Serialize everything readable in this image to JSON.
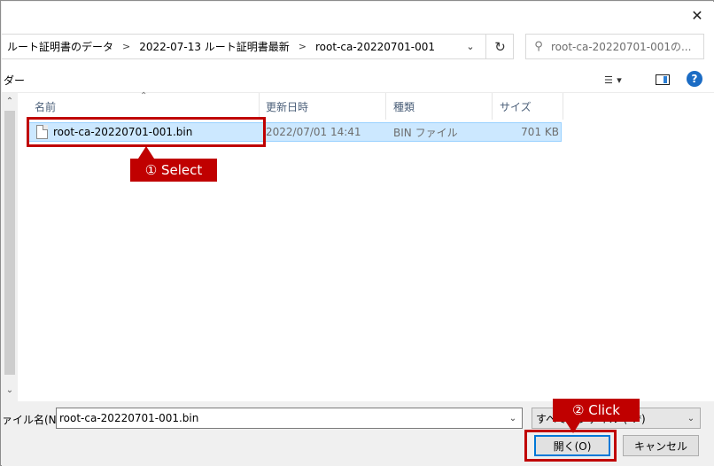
{
  "window": {
    "close_glyph": "✕"
  },
  "address": {
    "crumbs": [
      "ルート証明書のデータ",
      "2022-07-13 ルート証明書最新",
      "root-ca-20220701-001"
    ],
    "separator": ">",
    "dropdown_icon": "chevron-down-icon",
    "refresh_icon": "refresh-icon"
  },
  "search": {
    "placeholder": "root-ca-20220701-001の...",
    "icon": "search-icon"
  },
  "toolbar": {
    "left_text": "ダー",
    "view_icon": "view-options-icon",
    "pane_icon": "preview-pane-icon",
    "help_label": "?"
  },
  "list": {
    "columns": [
      "名前",
      "更新日時",
      "種類",
      "サイズ"
    ],
    "rows": [
      {
        "name": "root-ca-20220701-001.bin",
        "date": "2022/07/01 14:41",
        "type": "BIN ファイル",
        "size": "701 KB",
        "selected": true
      }
    ]
  },
  "bottom": {
    "filename_label": "ァイル名(N):",
    "filename_value": "root-ca-20220701-001.bin",
    "filetype_value": "すべてのファイル (*.*)",
    "open_label": "開く(O)",
    "cancel_label": "キャンセル"
  },
  "annotations": {
    "select": "① Select",
    "click": "② Click",
    "color": "#c00000"
  }
}
